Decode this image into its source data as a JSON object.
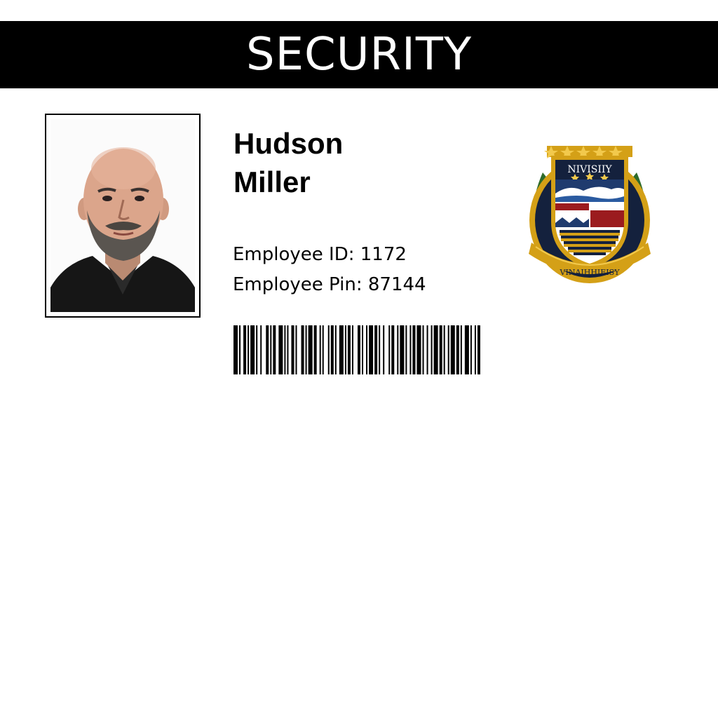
{
  "header": {
    "title": "SECURITY",
    "background": "#000000",
    "text_color": "#ffffff"
  },
  "employee": {
    "first_name": "Hudson",
    "last_name": "Miller",
    "id_label": "Employee ID: 1172",
    "pin_label": "Employee Pin: 87144"
  },
  "emblem": {
    "top_text": "NIVISIIY",
    "bottom_text": "VINAIHHIEISY",
    "colors": {
      "gold": "#d4a017",
      "navy": "#14213d",
      "red": "#9b1b1e",
      "green": "#2e6b2a"
    }
  },
  "barcode": {
    "pattern": [
      3,
      1,
      1,
      2,
      2,
      1,
      1,
      1,
      3,
      1,
      1,
      2,
      1,
      3,
      2,
      1,
      1,
      1,
      2,
      2,
      3,
      1,
      1,
      1,
      1,
      2,
      2,
      1,
      1,
      3,
      2,
      1,
      1,
      1,
      3,
      1,
      2,
      2,
      1,
      1,
      1,
      3,
      1,
      1,
      2,
      1,
      1,
      2,
      3,
      1,
      1,
      1,
      2,
      1,
      1,
      3,
      2,
      1,
      1,
      2,
      1,
      1,
      3,
      1,
      2,
      1,
      1,
      2,
      1,
      3,
      1,
      1,
      2,
      2,
      1,
      1,
      3,
      1,
      1,
      2,
      1,
      1,
      2,
      1,
      3,
      1,
      1,
      2,
      1,
      2,
      1,
      1,
      3,
      1,
      2,
      1,
      1,
      2,
      1,
      1,
      3,
      1,
      2,
      1,
      1,
      2,
      3,
      1,
      1,
      2,
      1,
      1,
      2,
      3
    ]
  }
}
